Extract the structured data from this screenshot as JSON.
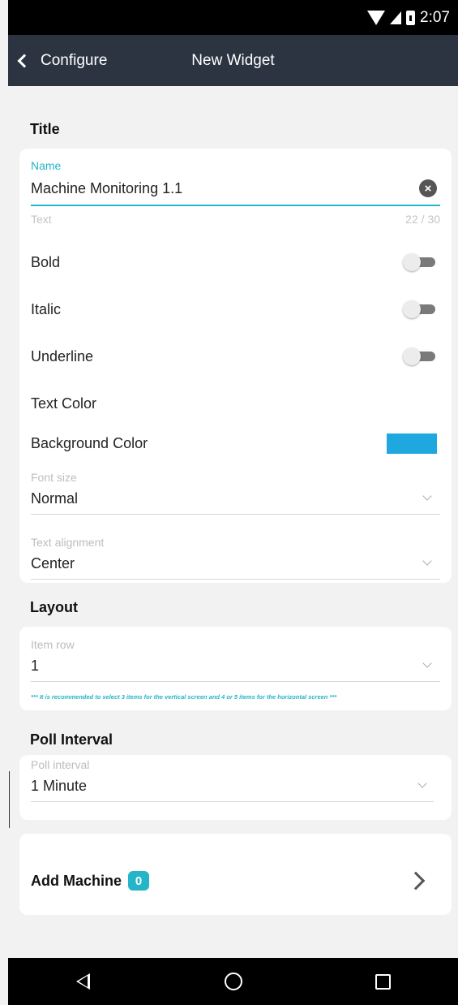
{
  "status_bar": {
    "time": "2:07"
  },
  "app_bar": {
    "back_label": "Configure",
    "title": "New Widget"
  },
  "title_section": {
    "heading": "Title",
    "name_field": {
      "label": "Name",
      "value": "Machine Monitoring 1.1",
      "helper": "Text",
      "counter": "22 / 30"
    },
    "toggles": [
      {
        "label": "Bold",
        "on": false
      },
      {
        "label": "Italic",
        "on": false
      },
      {
        "label": "Underline",
        "on": false
      }
    ],
    "text_color_label": "Text Color",
    "background_color_label": "Background Color",
    "background_color": "#1fa8df",
    "font_size": {
      "label": "Font size",
      "value": "Normal"
    },
    "text_alignment": {
      "label": "Text alignment",
      "value": "Center"
    }
  },
  "layout_section": {
    "heading": "Layout",
    "item_row": {
      "label": "Item row",
      "value": "1"
    },
    "note": "*** It is recommended to select 3 items for the vertical screen and 4 or 5 items for the horizontal screen ***"
  },
  "poll_section": {
    "heading": "Poll Interval",
    "poll_interval": {
      "label": "Poll interval",
      "value": "1 Minute"
    }
  },
  "add_machine": {
    "label": "Add Machine",
    "count": "0"
  },
  "colors": {
    "accent": "#25b5c8",
    "app_bar": "#2b3440"
  }
}
